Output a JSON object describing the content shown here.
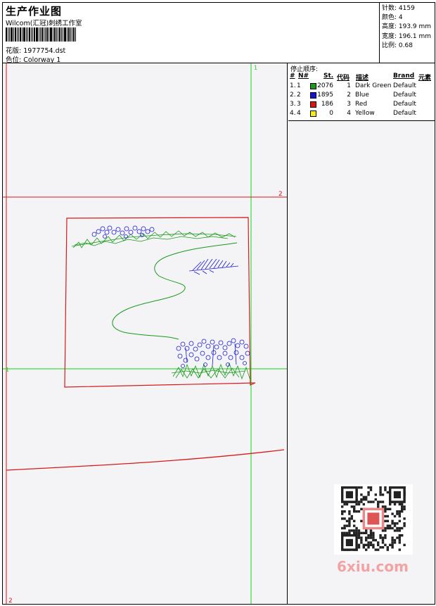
{
  "header": {
    "title": "生产作业图",
    "company": "Wilcom(汇冠)刺绣工作室",
    "design_label": "花版:",
    "design_value": "1977754.dst",
    "colorway_label": "色位:",
    "colorway_value": "Colorway 1"
  },
  "info": {
    "stitches": "针数: 4159",
    "colors": "颜色: 4",
    "height": "高度: 193.9 mm",
    "width": "宽度: 196.1 mm",
    "scale": "比例: 0.68"
  },
  "stop_sequence": {
    "title": "停止顺序:",
    "headers": [
      "#",
      "N#",
      "St.",
      "代码",
      "描述",
      "Brand",
      "元素"
    ],
    "rows": [
      {
        "num": "1.",
        "n": "1",
        "color": "#1a9a1a",
        "stitches": "2076",
        "code": "1",
        "desc": "Dark Green",
        "brand": "Default"
      },
      {
        "num": "2.",
        "n": "2",
        "color": "#1313d6",
        "stitches": "1895",
        "code": "2",
        "desc": "Blue",
        "brand": "Default"
      },
      {
        "num": "3.",
        "n": "3",
        "color": "#e01313",
        "stitches": "186",
        "code": "3",
        "desc": "Red",
        "brand": "Default"
      },
      {
        "num": "4.",
        "n": "4",
        "color": "#f2ee13",
        "stitches": "0",
        "code": "4",
        "desc": "Yellow",
        "brand": "Default"
      }
    ]
  },
  "guides": {
    "green_top": "1",
    "red_right": "2",
    "green_left": "1",
    "red_bottom": "2"
  },
  "watermark": "6xiu.com",
  "colors": {
    "green": "#19d419",
    "red": "#d61a1a",
    "blue": "#1a1ad6",
    "dark_green": "#1a9a1a"
  }
}
